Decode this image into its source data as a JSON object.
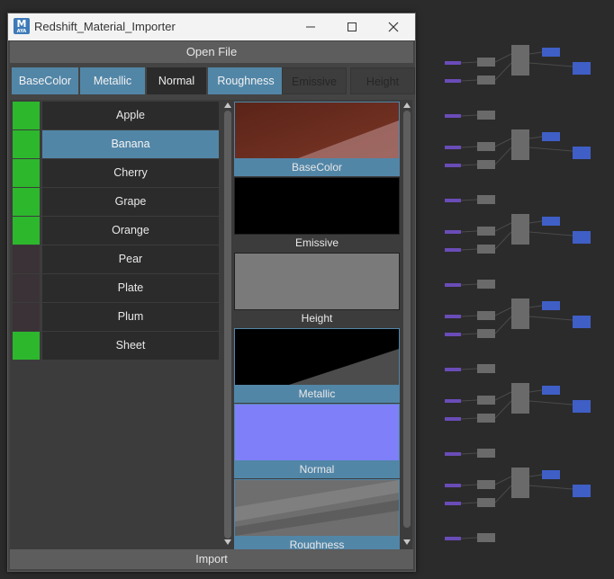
{
  "window": {
    "title": "Redshift_Material_Importer",
    "icon_letter": "M",
    "icon_sub": "AYA",
    "minimize_label": "—",
    "maximize_label": "☐",
    "close_label": "✕"
  },
  "toolbar": {
    "open_file_label": "Open File"
  },
  "tabs": [
    {
      "label": "BaseColor",
      "state": "active"
    },
    {
      "label": "Metallic",
      "state": "active"
    },
    {
      "label": "Normal",
      "state": "normal"
    },
    {
      "label": "Roughness",
      "state": "active"
    },
    {
      "label": "Emissive",
      "state": "disabled"
    },
    {
      "label": "Height",
      "state": "disabled"
    }
  ],
  "materials": [
    {
      "label": "Apple",
      "enabled": true,
      "selected": false
    },
    {
      "label": "Banana",
      "enabled": true,
      "selected": true
    },
    {
      "label": "Cherry",
      "enabled": true,
      "selected": false
    },
    {
      "label": "Grape",
      "enabled": true,
      "selected": false
    },
    {
      "label": "Orange",
      "enabled": true,
      "selected": false
    },
    {
      "label": "Pear",
      "enabled": false,
      "selected": false
    },
    {
      "label": "Plate",
      "enabled": false,
      "selected": false
    },
    {
      "label": "Plum",
      "enabled": false,
      "selected": false
    },
    {
      "label": "Sheet",
      "enabled": true,
      "selected": false
    }
  ],
  "previews": [
    {
      "label": "BaseColor",
      "selected": true
    },
    {
      "label": "Emissive",
      "selected": false
    },
    {
      "label": "Height",
      "selected": false
    },
    {
      "label": "Metallic",
      "selected": true
    },
    {
      "label": "Normal",
      "selected": true
    },
    {
      "label": "Roughness",
      "selected": true
    }
  ],
  "footer": {
    "import_label": "Import"
  },
  "colors": {
    "accent": "#5286a7",
    "enabled_swatch": "#2db72d",
    "disabled_swatch": "#3a3236",
    "panel_bg": "#444444",
    "editor_bg": "#2b2b2b",
    "node_purple": "#6a4cb8",
    "node_blue": "#3f5fc6",
    "node_gray": "#6a6a6a"
  }
}
